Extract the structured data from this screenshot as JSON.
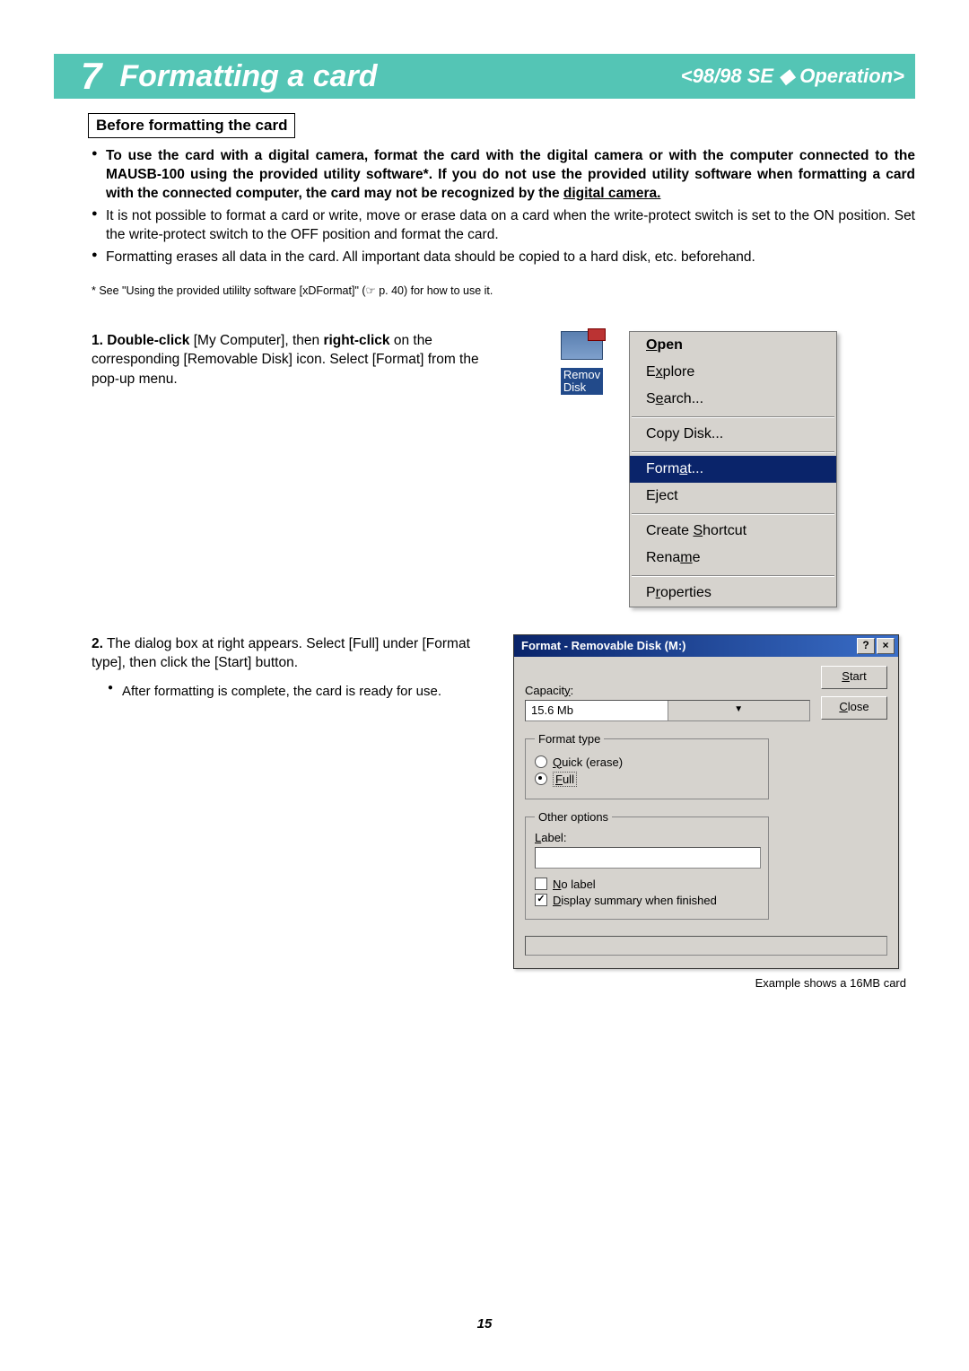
{
  "header": {
    "number": "7",
    "title": "Formatting a card",
    "operation": "<98/98 SE ◆ Operation>"
  },
  "section_heading": "Before formatting the card",
  "warnings": {
    "b1_bold_lead": "To use the card with a digital camera, format the card with the digital camera or with the computer connected to the MAUSB-100 using the provided utility software*. If you do not use the provided utility software when formatting a card with the connected computer, the card may not be recognized by the ",
    "b1_bold_underline": "digital camera.",
    "b2": "It is not possible to format a card or write, move or erase data on a card when the write-protect switch is set to the ON position. Set the write-protect switch to the OFF position and format the card.",
    "b3": "Formatting erases all data in the card. All important data should be copied to a hard disk, etc. beforehand."
  },
  "footnote": "* See \"Using the provided utililty software [xDFormat]\" (☞ p. 40) for how to use it.",
  "step1": {
    "num": "1.",
    "bold_a": "Double-click",
    "plain_a": " [My Computer], then ",
    "bold_b": "right-click",
    "plain_b": " on the corresponding [Removable Disk] icon. Select [Format] from the pop-up menu."
  },
  "drive_label_line1": "Remov",
  "drive_label_line2": "Disk",
  "menu": {
    "open_pre": "O",
    "open_rest": "pen",
    "explore_pre": "E",
    "explore_ul": "x",
    "explore_rest": "plore",
    "search_pre": "S",
    "search_ul": "e",
    "search_rest": "arch...",
    "copy": "Copy Disk...",
    "format_pre": "Form",
    "format_ul": "a",
    "format_rest": "t...",
    "eject_pre": "E",
    "eject_ul": "j",
    "eject_rest": "ect",
    "shortcut_pre": "Create ",
    "shortcut_ul": "S",
    "shortcut_rest": "hortcut",
    "rename_pre": "Rena",
    "rename_ul": "m",
    "rename_rest": "e",
    "props_pre": "P",
    "props_ul": "r",
    "props_rest": "operties"
  },
  "step2": {
    "num": "2.",
    "text": "The dialog box at right appears. Select [Full] under [Format type], then click the [Start] button.",
    "sub": "After formatting is complete, the card is ready for use."
  },
  "dialog": {
    "title": "Format - Removable Disk (M:)",
    "help": "?",
    "close": "×",
    "capacity_label_pre": "Capacit",
    "capacity_label_ul": "y",
    "capacity_label_post": ":",
    "capacity_value": "15.6 Mb",
    "start_ul": "S",
    "start_rest": "tart",
    "close_ul": "C",
    "close_rest": "lose",
    "format_type": "Format type",
    "quick_ul": "Q",
    "quick_rest": "uick (erase)",
    "full_ul": "F",
    "full_rest": "ull",
    "other_options": "Other options",
    "label_ul": "L",
    "label_rest": "abel:",
    "nolabel_ul": "N",
    "nolabel_rest": "o label",
    "summary_ul": "D",
    "summary_rest": "isplay summary when finished"
  },
  "example_note": "Example shows a 16MB card",
  "page_number": "15"
}
